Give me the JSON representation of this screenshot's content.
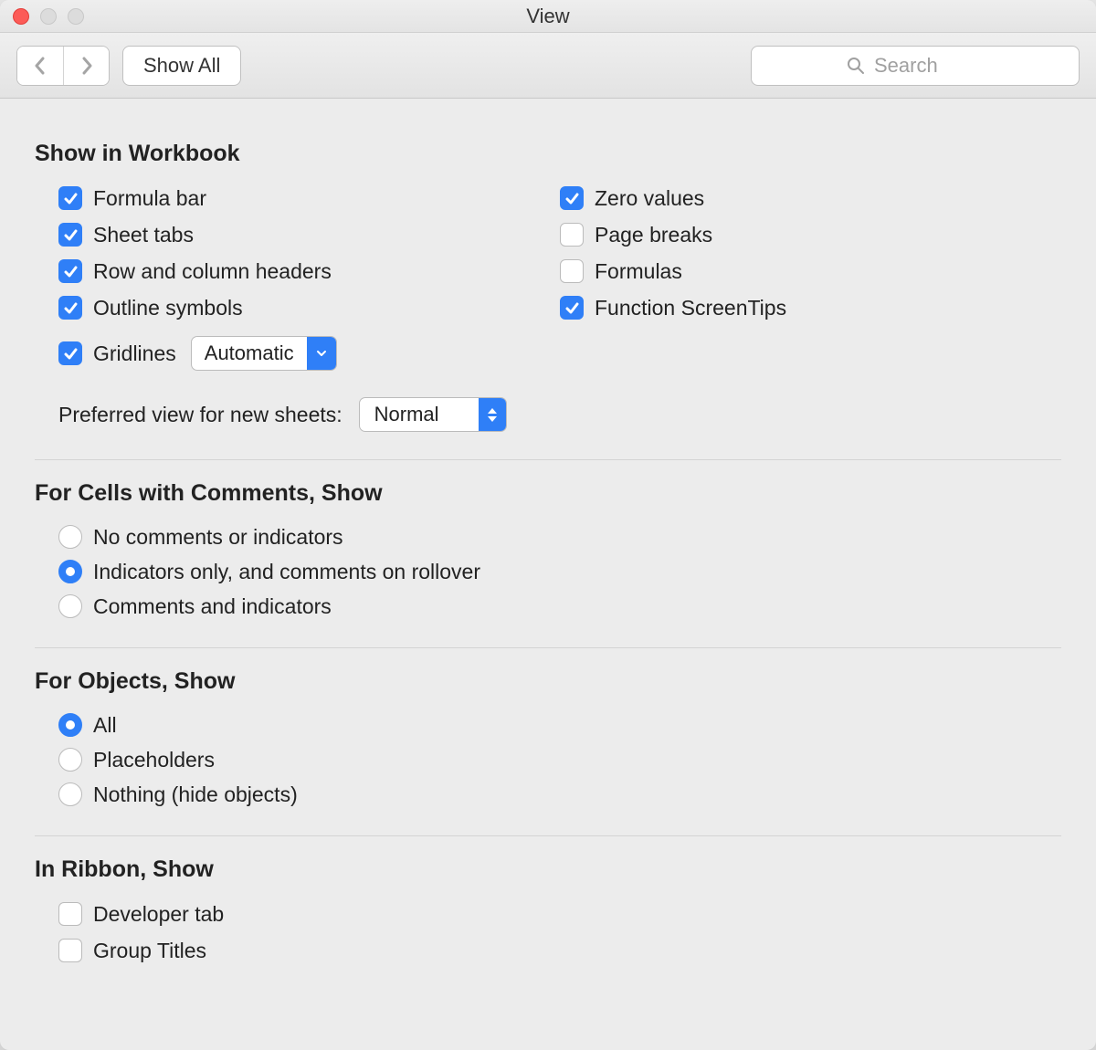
{
  "window": {
    "title": "View"
  },
  "toolbar": {
    "show_all_label": "Show All",
    "search_placeholder": "Search"
  },
  "sections": {
    "show_in_workbook": {
      "title": "Show in Workbook",
      "left": {
        "formula_bar": "Formula bar",
        "sheet_tabs": "Sheet tabs",
        "row_col_headers": "Row and column headers",
        "outline_symbols": "Outline symbols",
        "gridlines": "Gridlines"
      },
      "right": {
        "zero_values": "Zero values",
        "page_breaks": "Page breaks",
        "formulas": "Formulas",
        "function_screentips": "Function ScreenTips"
      },
      "gridlines_select": "Automatic",
      "preferred_view_label": "Preferred view for new sheets:",
      "preferred_view_value": "Normal"
    },
    "comments": {
      "title": "For Cells with Comments, Show",
      "opts": {
        "none": "No comments or indicators",
        "indicators": "Indicators only, and comments on rollover",
        "both": "Comments and indicators"
      }
    },
    "objects": {
      "title": "For Objects, Show",
      "opts": {
        "all": "All",
        "placeholders": "Placeholders",
        "nothing": "Nothing (hide objects)"
      }
    },
    "ribbon": {
      "title": "In Ribbon, Show",
      "opts": {
        "developer": "Developer tab",
        "group_titles": "Group Titles"
      }
    }
  },
  "state": {
    "checkboxes": {
      "formula_bar": true,
      "sheet_tabs": true,
      "row_col_headers": true,
      "outline_symbols": true,
      "gridlines": true,
      "zero_values": true,
      "page_breaks": false,
      "formulas": false,
      "function_screentips": true,
      "developer": false,
      "group_titles": false
    },
    "radios": {
      "comments": "indicators",
      "objects": "all"
    }
  }
}
